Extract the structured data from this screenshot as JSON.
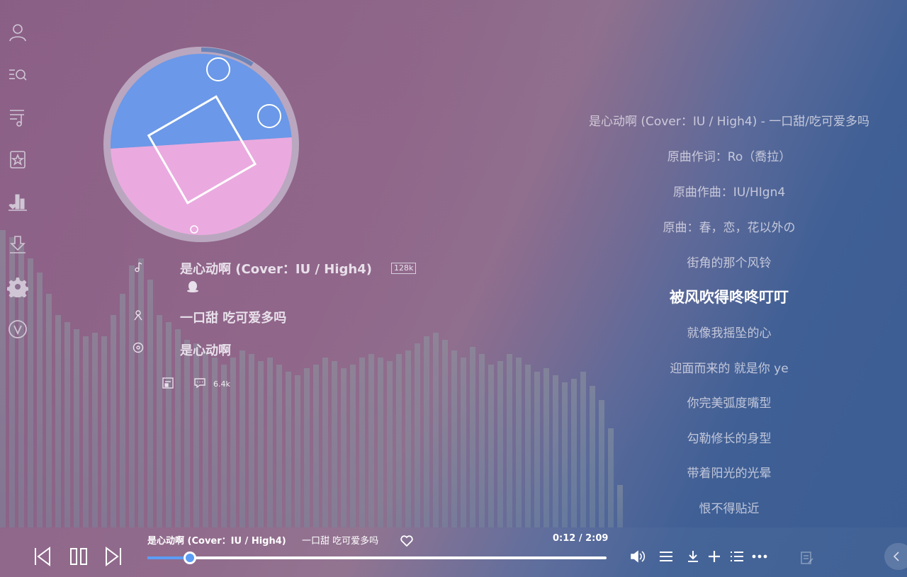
{
  "sidebar": {
    "items": [
      {
        "name": "user-icon"
      },
      {
        "name": "search-icon"
      },
      {
        "name": "playlist-icon"
      },
      {
        "name": "favorites-icon"
      },
      {
        "name": "chart-icon"
      },
      {
        "name": "download-icon"
      },
      {
        "name": "settings-icon"
      },
      {
        "name": "vip-icon"
      }
    ]
  },
  "song": {
    "title": "是心动啊 (Cover：IU / High4)",
    "quality": "128k",
    "artist": "一口甜 吃可爱多吗",
    "album": "是心动啊",
    "comment_count": "6.4k"
  },
  "lyrics": {
    "lines": [
      "是心动啊 (Cover：IU / High4) - 一口甜/吃可爱多吗",
      "原曲作词：Ro（喬拉）",
      "原曲作曲：IU/HIgn4",
      "原曲：春，恋，花以外の",
      "街角的那个风铃",
      "被风吹得咚咚叮叮",
      "就像我摇坠的心",
      "迎面而来的 就是你 ye",
      "你完美弧度嘴型",
      "勾勒修长的身型",
      "带着阳光的光晕",
      "恨不得贴近"
    ],
    "active_index": 5
  },
  "player": {
    "title": "是心动啊 (Cover：IU / High4)",
    "artist": "一口甜 吃可爱多吗",
    "time": "0:12 / 2:09",
    "progress_fraction": 0.093
  },
  "colors": {
    "accent": "#5a9cf5"
  }
}
